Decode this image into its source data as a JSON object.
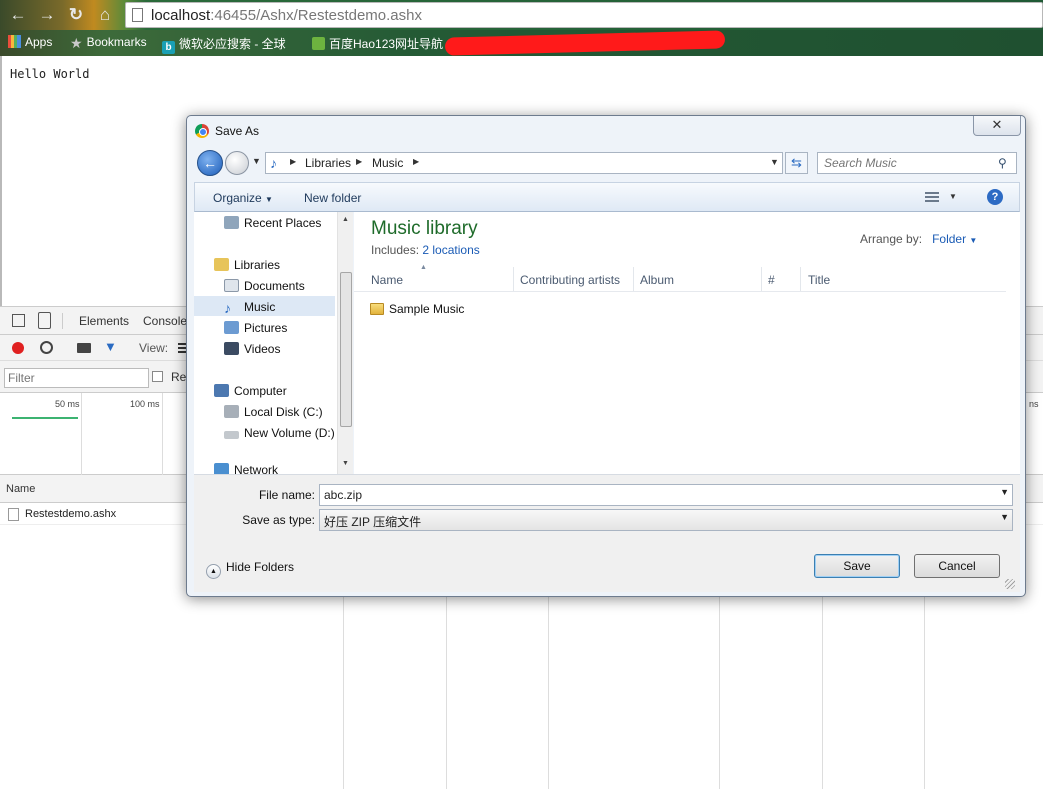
{
  "browser": {
    "url_host": "localhost",
    "url_rest": ":46455/Ashx/Restestdemo.ashx",
    "bookmarks": [
      "Apps",
      "Bookmarks",
      "微软必应搜索 - 全球",
      "百度Hao123网址导航"
    ]
  },
  "page": {
    "body_text": "Hello World"
  },
  "devtools": {
    "tabs": [
      "Elements",
      "Console"
    ],
    "view_label": "View:",
    "filter_placeholder": "Filter",
    "regex_label": "Re",
    "ticks": [
      "50 ms",
      "100 ms"
    ],
    "right_tick": "ns",
    "name_header": "Name",
    "rows": [
      {
        "name": "Restestdemo.ashx"
      }
    ],
    "colors": {
      "record": "#e02020",
      "timeline_bar": "#3cb371"
    }
  },
  "dialog": {
    "title": "Save As",
    "close_glyph": "✕",
    "breadcrumb": [
      "Libraries",
      "Music"
    ],
    "search_placeholder": "Search Music",
    "toolbar": {
      "organize": "Organize",
      "new_folder": "New folder"
    },
    "nav": {
      "items": [
        {
          "label": "Recent Places",
          "icon": "recent-places-icon"
        },
        {
          "label": "Libraries",
          "icon": "libraries-icon"
        },
        {
          "label": "Documents",
          "icon": "documents-icon"
        },
        {
          "label": "Music",
          "icon": "music-icon"
        },
        {
          "label": "Pictures",
          "icon": "pictures-icon"
        },
        {
          "label": "Videos",
          "icon": "videos-icon"
        },
        {
          "label": "Computer",
          "icon": "computer-icon"
        },
        {
          "label": "Local Disk (C:)",
          "icon": "local-disk-icon"
        },
        {
          "label": "New Volume (D:)",
          "icon": "drive-icon"
        },
        {
          "label": "Network",
          "icon": "network-icon"
        }
      ],
      "selected": "Music"
    },
    "library": {
      "title": "Music library",
      "includes_label": "Includes:",
      "includes_link": "2 locations",
      "arrange_label": "Arrange by:",
      "arrange_value": "Folder"
    },
    "columns": [
      "Name",
      "Contributing artists",
      "Album",
      "#",
      "Title"
    ],
    "files": [
      {
        "name": "Sample Music",
        "type": "folder"
      }
    ],
    "file_name_label": "File name:",
    "file_name_value": "abc.zip",
    "save_type_label": "Save as type:",
    "save_type_value": "好压 ZIP 压缩文件",
    "hide_folders": "Hide Folders",
    "save_button": "Save",
    "cancel_button": "Cancel",
    "accent_title_color": "#1e6b2a",
    "link_color": "#1a5bb5"
  }
}
